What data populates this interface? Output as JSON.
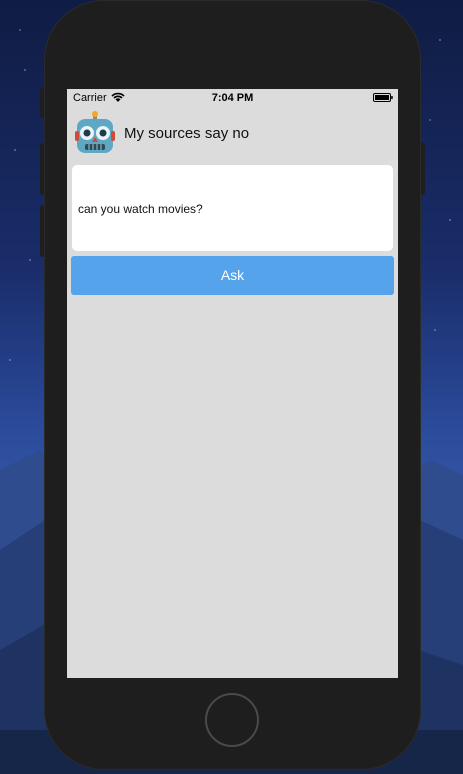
{
  "status_bar": {
    "carrier": "Carrier",
    "time": "7:04 PM"
  },
  "header": {
    "status_text": "My sources say no"
  },
  "question": {
    "value": "can you watch movies?"
  },
  "ask_button": {
    "label": "Ask"
  },
  "icons": {
    "robot": "robot-icon",
    "wifi": "wifi-icon",
    "battery": "battery-icon"
  },
  "colors": {
    "screen_background": "#dcdcdc",
    "button": "#55a3ea",
    "button_text": "#ffffff",
    "phone_frame": "#1e1e1e"
  }
}
